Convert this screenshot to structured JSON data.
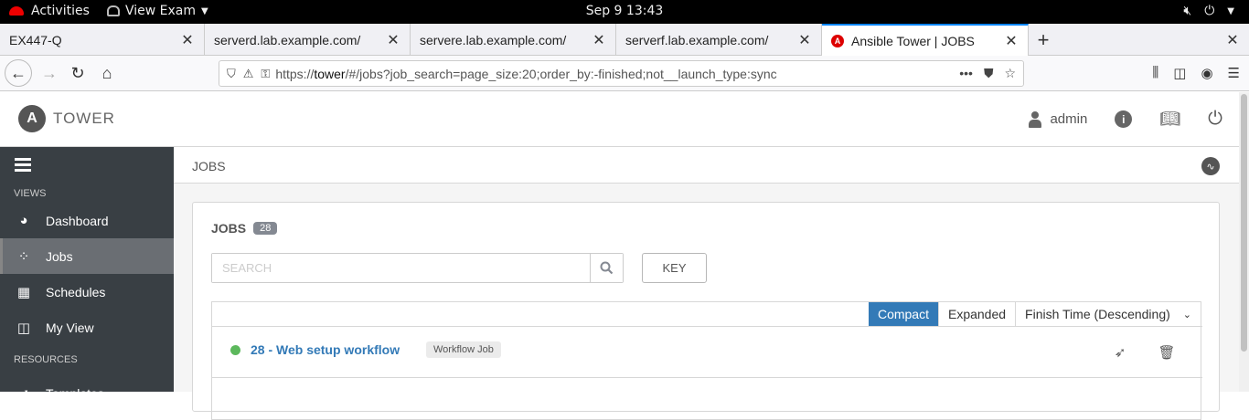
{
  "system_bar": {
    "activities": "Activities",
    "app_menu": "View Exam",
    "clock": "Sep 9  13:43"
  },
  "browser": {
    "tabs": [
      {
        "label": "EX447-Q"
      },
      {
        "label": "serverd.lab.example.com/"
      },
      {
        "label": "servere.lab.example.com/"
      },
      {
        "label": "serverf.lab.example.com/"
      },
      {
        "label": "Ansible Tower | JOBS"
      }
    ],
    "url_prefix": "https://",
    "url_host": "tower",
    "url_rest": "/#/jobs?job_search=page_size:20;order_by:-finished;not__launch_type:sync"
  },
  "tower": {
    "logo_text": "TOWER",
    "user": "admin",
    "breadcrumb": "JOBS"
  },
  "sidebar": {
    "section_views": "VIEWS",
    "section_resources": "RESOURCES",
    "items": [
      {
        "label": "Dashboard",
        "icon": "dashboard-icon"
      },
      {
        "label": "Jobs",
        "icon": "spinner-icon"
      },
      {
        "label": "Schedules",
        "icon": "calendar-icon"
      },
      {
        "label": "My View",
        "icon": "columns-icon"
      },
      {
        "label": "Templates",
        "icon": "rocket-icon"
      }
    ]
  },
  "jobs_panel": {
    "title": "JOBS",
    "count": "28",
    "search_placeholder": "SEARCH",
    "key_label": "KEY",
    "view_compact": "Compact",
    "view_expanded": "Expanded",
    "sort_label": "Finish Time (Descending)",
    "rows": [
      {
        "name": "28 - Web setup workflow",
        "type": "Workflow Job",
        "status": "successful"
      }
    ]
  },
  "colors": {
    "sidebar_bg": "#393f44",
    "link_blue": "#337ab7",
    "success_green": "#5cb85c"
  }
}
